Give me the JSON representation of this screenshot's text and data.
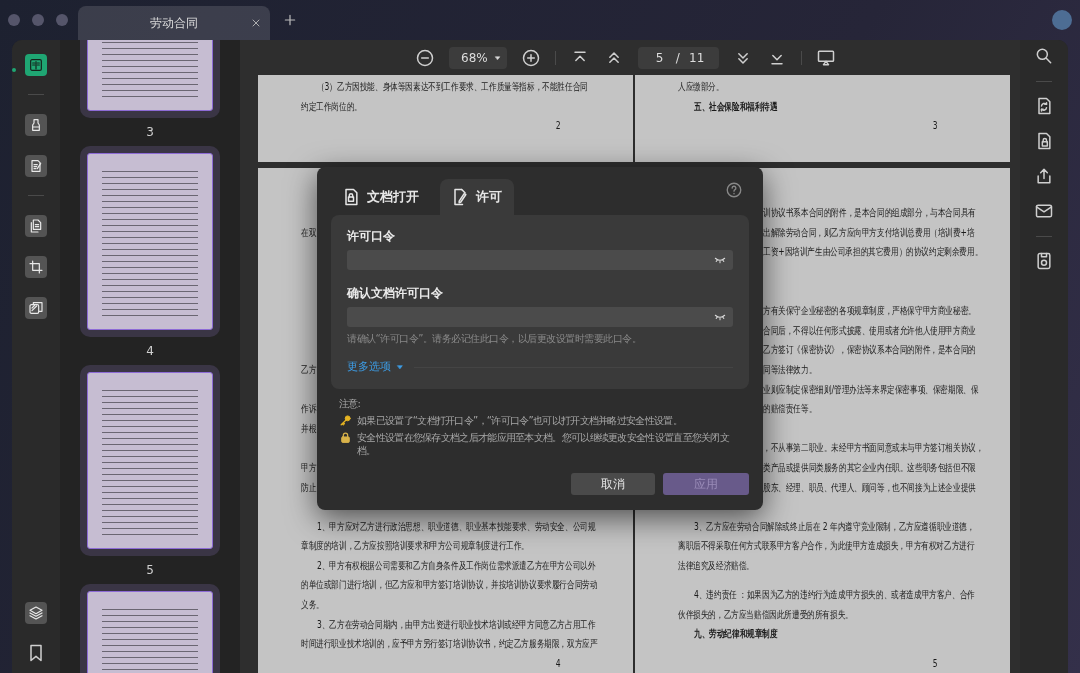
{
  "window": {
    "tab_title": "劳动合同"
  },
  "left_tools": {
    "groups": [
      [
        {
          "kind": "reader",
          "selected": true
        }
      ],
      [
        {
          "kind": "comment",
          "selected": false
        },
        {
          "kind": "edit",
          "selected": false
        }
      ],
      [
        {
          "kind": "organize",
          "selected": false
        },
        {
          "kind": "crop",
          "selected": false
        },
        {
          "kind": "watermark",
          "selected": false
        }
      ]
    ],
    "bottom": [
      {
        "kind": "layers"
      },
      {
        "kind": "bookmark"
      }
    ]
  },
  "thumbnails": [
    {
      "label": "3",
      "selected": true
    },
    {
      "label": "4",
      "selected": true
    },
    {
      "label": "5",
      "selected": true
    },
    {
      "selected": true
    }
  ],
  "toolbar": {
    "zoom": "68%",
    "page": "5",
    "page_separator": "/",
    "page_count": "11"
  },
  "spreads": [
    {
      "left": {
        "lines": [
          {
            "kind": "indent",
            "text": "（3）乙方因技能、身体等因素达不到工作要求、工作质量等指标，不能胜任合同"
          },
          {
            "kind": "body",
            "text": "约定工作岗位的。"
          },
          {
            "kind": "page_number",
            "text": "2"
          }
        ]
      },
      "right": {
        "lines": [
          {
            "kind": "body",
            "text": "人应缴部分。"
          },
          {
            "kind": "heading",
            "text": "五、社会保险和福利待遇"
          },
          {
            "kind": "page_number",
            "text": "3"
          }
        ]
      }
    },
    {
      "left": {
        "lines": [
          {
            "kind": "body",
            "text": "在双"
          },
          {
            "kind": "body",
            "text": "乙方"
          },
          {
            "kind": "body",
            "text": "作诉"
          },
          {
            "kind": "body",
            "text": "并根"
          },
          {
            "kind": "body",
            "text": "甲方"
          },
          {
            "kind": "body",
            "text": "防止"
          },
          {
            "kind": "indent",
            "text": "1、甲方应对乙方进行政治思想、职业道德、职业基本技能要求、劳动安全、公司规"
          },
          {
            "kind": "body",
            "text": "章制度的培训，乙方应按照培训要求和甲方公司规章制度进行工作。"
          },
          {
            "kind": "indent",
            "text": "2、甲方有权根据公司需要和乙方自身条件及工作岗位需求派遣乙方在甲方公司以外"
          },
          {
            "kind": "body",
            "text": "的单位或部门进行培训，但乙方应和甲方签订培训协议，并按培训协议要求履行合同劳动"
          },
          {
            "kind": "body",
            "text": "义务。"
          },
          {
            "kind": "indent",
            "text": "3、乙方在劳动合同期内，由甲方出资进行职业技术培训或经甲方同意乙方占用工作"
          },
          {
            "kind": "body",
            "text": "时间进行职业技术培训的，应予甲方另行签订培训协议书，约定乙方服务期限，双方应严"
          },
          {
            "kind": "page_number",
            "text": "4"
          }
        ]
      },
      "right": {
        "lines": [
          {
            "kind": "fragment",
            "text": "训协议书系本合同的附件，是本合同的组成部分，与本合同具有"
          },
          {
            "kind": "fragment",
            "text": "出解除劳动合同，则乙方应向甲方支付培训总费用（培训费+培"
          },
          {
            "kind": "fragment",
            "text": "工资+因培训产生由公司承担的其它费用）的协议约定剩余费用。"
          },
          {
            "kind": "fragment",
            "text": "方有关保守企业秘密的各项规章制度，严格保守甲方商业秘密。"
          },
          {
            "kind": "fragment",
            "text": "合同后，不得以任何形式披露、使用或者允许他人使用甲方商业"
          },
          {
            "kind": "fragment",
            "text": "乙方签订《保密协议》，保密协议系本合同的附件，是本合同的"
          },
          {
            "kind": "fragment",
            "text": "同等法律效力。"
          },
          {
            "kind": "fragment",
            "text": "业则应制定保密细则/管理办法等来界定保密事项、保密期限、保"
          },
          {
            "kind": "fragment",
            "text": "的赔偿责任等。"
          },
          {
            "kind": "fragment",
            "text": "，不从事第二职业。未经甲方书面同意或未与甲方签订相关协议，"
          },
          {
            "kind": "fragment",
            "text": "类产品或提供同类服务的其它企业内任职。这些职务包括但不限"
          },
          {
            "kind": "fragment",
            "text": "股东、经理、职员、代理人、顾问等，也不间接为上述企业提供"
          },
          {
            "kind": "indent",
            "text": "3、乙方应在劳动合同解除或终止后在 2 年内遵守竞业限制，乙方应遵循职业道德，"
          },
          {
            "kind": "body",
            "text": "离职后不得采取任何方式联系甲方客户合作，为此使甲方造成损失，甲方有权对乙方进行"
          },
          {
            "kind": "body",
            "text": "法律追究及经济赔偿。"
          },
          {
            "kind": "indent",
            "text": "4、违约责任 ：如果因为乙方的违约行为造成甲方损失的、或者造成甲方客户、合作"
          },
          {
            "kind": "body",
            "text": "伙伴损失的，乙方应当赔偿因此所遭受的所有损失。"
          },
          {
            "kind": "heading",
            "text": "九、劳动纪律和规章制度"
          },
          {
            "kind": "page_number",
            "text": "5"
          }
        ]
      }
    }
  ],
  "right_tools": {
    "groups": [
      [
        {
          "kind": "search"
        }
      ],
      [
        {
          "kind": "convert"
        },
        {
          "kind": "protect"
        },
        {
          "kind": "share"
        },
        {
          "kind": "mail"
        }
      ],
      [
        {
          "kind": "save"
        }
      ]
    ]
  },
  "dialog": {
    "tabs": [
      {
        "label": "文档打开",
        "kind": "open",
        "selected": false
      },
      {
        "label": "许可",
        "kind": "permission",
        "selected": true
      }
    ],
    "fields": [
      {
        "label": "许可口令"
      },
      {
        "label": "确认文档许可口令"
      }
    ],
    "hint": "请确认“许可口令”。请务必记住此口令，以后更改设置时需要此口令。",
    "more_options": "更多选项",
    "note_title": "注意:",
    "notes": [
      {
        "kind": "key",
        "text": "如果已设置了“文档打开口令”，“许可口令”也可以打开文档并略过安全性设置。"
      },
      {
        "kind": "lock",
        "text": "安全性设置在您保存文档之后才能应用至本文档。您可以继续更改安全性设置直至您关闭文档。"
      }
    ],
    "buttons": [
      {
        "label": "取消",
        "kind": "cancel",
        "disabled": false
      },
      {
        "label": "应用",
        "kind": "apply",
        "disabled": true
      }
    ]
  }
}
